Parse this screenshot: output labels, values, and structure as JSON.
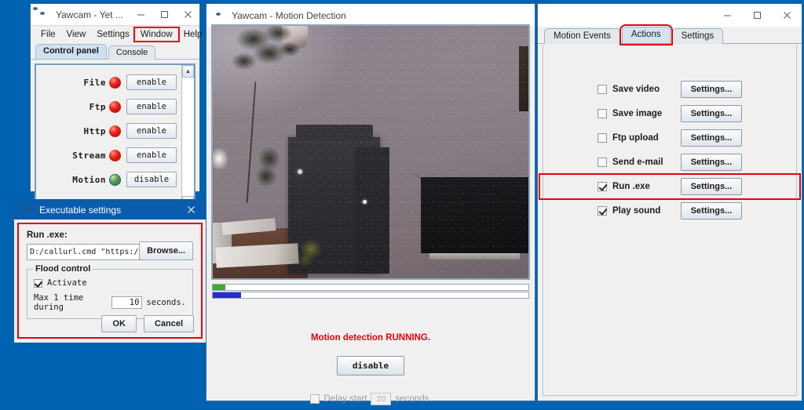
{
  "desktop": {
    "background": "#0063b1"
  },
  "yawcam_window": {
    "title": "Yawcam - Yet ...",
    "icon": "globe-icon",
    "controls": {
      "minimize": "–",
      "maximize": "□",
      "close": "✕"
    },
    "menu": [
      {
        "label": "File",
        "highlighted": false
      },
      {
        "label": "View",
        "highlighted": false
      },
      {
        "label": "Settings",
        "highlighted": false
      },
      {
        "label": "Window",
        "highlighted": true
      },
      {
        "label": "Help",
        "highlighted": false
      }
    ],
    "tabs": [
      {
        "label": "Control panel",
        "selected": true
      },
      {
        "label": "Console",
        "selected": false
      }
    ],
    "control_panel": {
      "rows": [
        {
          "label": "File",
          "led": "red",
          "button": "enable"
        },
        {
          "label": "Ftp",
          "led": "red",
          "button": "enable"
        },
        {
          "label": "Http",
          "led": "red",
          "button": "enable"
        },
        {
          "label": "Stream",
          "led": "red",
          "button": "enable"
        },
        {
          "label": "Motion",
          "led": "globe",
          "button": "disable"
        }
      ],
      "scroll_up": "▲",
      "scroll_down": "▼"
    }
  },
  "exe_dialog": {
    "title": "Executable settings",
    "icon": "globe-icon",
    "close": "✕",
    "run_exe_label": "Run .exe:",
    "run_exe_value": "D:/callurl.cmd \"https://www.pus",
    "browse_label": "Browse...",
    "flood_control": {
      "group_title": "Flood control",
      "activate_label": "Activate",
      "activate_checked": true,
      "prefix": "Max 1 time during",
      "seconds_value": "10",
      "suffix": "seconds."
    },
    "ok_label": "OK",
    "cancel_label": "Cancel",
    "highlight_color": "#e8000d"
  },
  "motion_window": {
    "title": "Yawcam - Motion Detection",
    "icon": "globe-icon",
    "controls": {
      "minimize": "–",
      "maximize": "□",
      "close": "✕"
    },
    "video": {
      "alt": "webcam-live-view"
    },
    "bars": [
      {
        "name": "motion-level-bar",
        "color": "#3fa832",
        "fill_percent": 4
      },
      {
        "name": "threshold-bar",
        "color": "#2a2ad0",
        "fill_percent": 9
      }
    ],
    "status_text": "Motion detection RUNNING.",
    "status_color": "#e8000d",
    "disable_button": "disable",
    "delay": {
      "checkbox_checked": false,
      "label": "Delay start",
      "value": "20",
      "suffix": "seconds."
    }
  },
  "actions_panel": {
    "tabs": [
      {
        "label": "Motion Events",
        "selected": false,
        "highlighted": false
      },
      {
        "label": "Actions",
        "selected": true,
        "highlighted": true
      },
      {
        "label": "Settings",
        "selected": false,
        "highlighted": false
      }
    ],
    "controls": {
      "minimize": "–",
      "maximize": "□",
      "close": "✕"
    },
    "rows": [
      {
        "label": "Save video",
        "checked": false,
        "button": "Settings...",
        "highlighted": false
      },
      {
        "label": "Save image",
        "checked": false,
        "button": "Settings...",
        "highlighted": false
      },
      {
        "label": "Ftp upload",
        "checked": false,
        "button": "Settings...",
        "highlighted": false
      },
      {
        "label": "Send e-mail",
        "checked": false,
        "button": "Settings...",
        "highlighted": false
      },
      {
        "label": "Run .exe",
        "checked": true,
        "button": "Settings...",
        "highlighted": true
      },
      {
        "label": "Play sound",
        "checked": true,
        "button": "Settings...",
        "highlighted": false
      }
    ]
  }
}
